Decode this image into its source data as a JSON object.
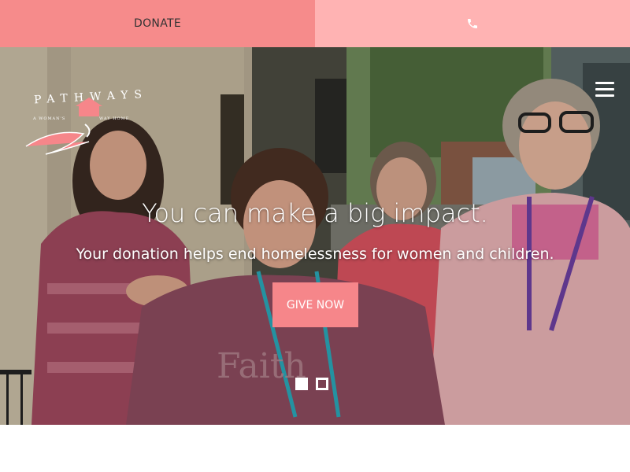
{
  "topbar": {
    "donate_label": "DONATE",
    "phone_icon": "phone-icon",
    "donate_bg": "#f68b8b",
    "phone_bg": "#ffb3b3"
  },
  "header": {
    "logo_text": "PATHWAYS",
    "logo_tagline": "A WOMAN'S WAY HOME",
    "menu_icon": "hamburger-menu-icon"
  },
  "hero": {
    "headline": "You can make a big impact.",
    "subline": "Your donation helps end homelessness for women and children.",
    "cta_label": "GIVE NOW",
    "accent": "#f6868a",
    "carousel": {
      "slides": 2,
      "active": 1
    }
  }
}
